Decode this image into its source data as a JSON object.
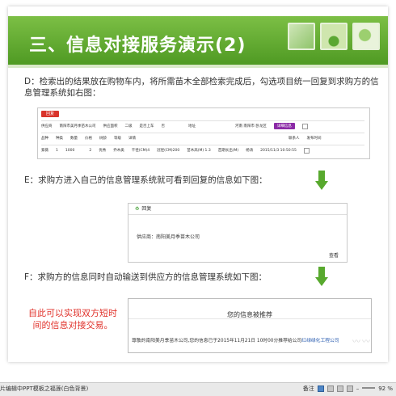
{
  "slide": {
    "title": "三、信息对接服务演示(2)",
    "para_d": "D：检索出的结果放在购物车内，将所需苗木全部检索完成后，勾选项目统一回复到求购方的信息管理系统如右图：",
    "para_e": "E：求购方进入自己的信息管理系统就可看到回复的信息如下图：",
    "para_f": "F：求购方的信息同时自动输送到供应方的信息管理系统如下图：",
    "red_note": "自此可以实现双方短时间的信息对接交易。",
    "colors": {
      "title_green": "#5aa731",
      "red_note": "#e0322b",
      "arrow_green": "#58a92e"
    },
    "icons": [
      "down-arrow-icon",
      "recycle-icon",
      "checkbox-icon"
    ]
  },
  "panel1": {
    "reply_button": "回复",
    "row1": [
      "供应商",
      "南阳市美月季苗木公司",
      "供应面积",
      "二级",
      "是否上车",
      "否",
      "地址",
      "河南 南阳市 卧龙区",
      "详细信息"
    ],
    "row2": [
      "品种",
      "种类",
      "数量",
      "价格",
      "树龄",
      "等级",
      "详情",
      "",
      "",
      "",
      "",
      "",
      "联系人",
      "发布时间"
    ],
    "row3": [
      "紫薇",
      "1",
      "1000",
      "",
      "2",
      "优秀",
      "乔木类",
      "干径(CM)4",
      "冠径(CM)200",
      "苗木高(M) 1.3",
      "苗期长出(M)",
      "杨涛",
      "2015/11/3 10:50:55"
    ]
  },
  "panel2": {
    "header": "回复",
    "supplier_label": "供应商：南阳美月季苗木公司",
    "view_link": "查看"
  },
  "panel3": {
    "title": "您的信息被推荐",
    "body_prefix": "尊敬的南阳美月季苗木公司,您的信息已于2015年11月21日 10时00分推荐给公司",
    "body_link": "红绿绿化工程公司"
  },
  "status": {
    "left_text": "片编辑中PPT模板之福莲(白色背景)",
    "notes_label": "备注",
    "zoom": "92 %"
  }
}
